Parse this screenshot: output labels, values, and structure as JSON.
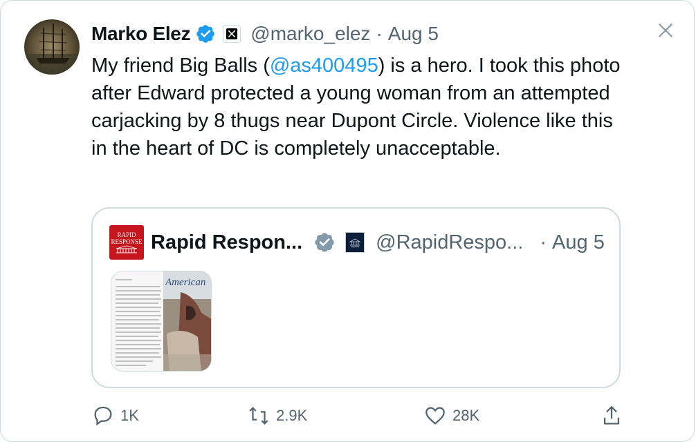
{
  "author": {
    "name": "Marko Elez",
    "handle": "@marko_elez",
    "separator": "·",
    "date": "Aug 5"
  },
  "tweet": {
    "text_before": "My friend Big Balls (",
    "mention": "@as400495",
    "text_after": ") is a hero. I took this photo after Edward protected a young woman from an attempted carjacking by 8 thugs near Dupont Circle. Violence like this in the heart of DC is completely unacceptable."
  },
  "quote": {
    "logo_line1": "RAPID",
    "logo_line2": "RESPONSE",
    "name": "Rapid Respon...",
    "handle": "@RapidRespo...",
    "separator": "·",
    "date": "Aug 5",
    "media_plane_text": "American"
  },
  "actions": {
    "reply_count": "1K",
    "repost_count": "2.9K",
    "like_count": "28K"
  },
  "icons": {
    "verified": "verified-badge-icon",
    "x_affiliate": "x-logo-icon",
    "close": "close-icon"
  },
  "colors": {
    "accent": "#1d9bf0",
    "secondary_text": "#536471",
    "border": "#cfd9de",
    "rapid_response_red": "#c4161c"
  }
}
